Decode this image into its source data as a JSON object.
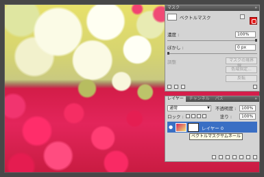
{
  "mask_panel": {
    "title": "マスク",
    "vector_mask_label": "ベクトルマスク",
    "density_label": "濃度 :",
    "density_value": "100%",
    "feather_label": "ぼかし :",
    "feather_value": "0 px",
    "adjust_label": "調整",
    "mask_edge_button": "マスクの境界線...",
    "color_range_button": "色域指定...",
    "invert_button": "反転"
  },
  "layers_panel": {
    "tabs": [
      "レイヤー",
      "チャンネル",
      "パス"
    ],
    "blend_mode": "通常",
    "opacity_label": "不透明度 :",
    "opacity_value": "100%",
    "lock_label": "ロック :",
    "fill_label": "塗り :",
    "fill_value": "100%",
    "layer_name": "レイヤー 0"
  },
  "tooltip": "ベクトルマスクサムネール",
  "colors": {
    "selection_blue": "#3a6fc4",
    "highlight_red": "#e31b1b",
    "panel_gray": "#d4d4d4"
  }
}
